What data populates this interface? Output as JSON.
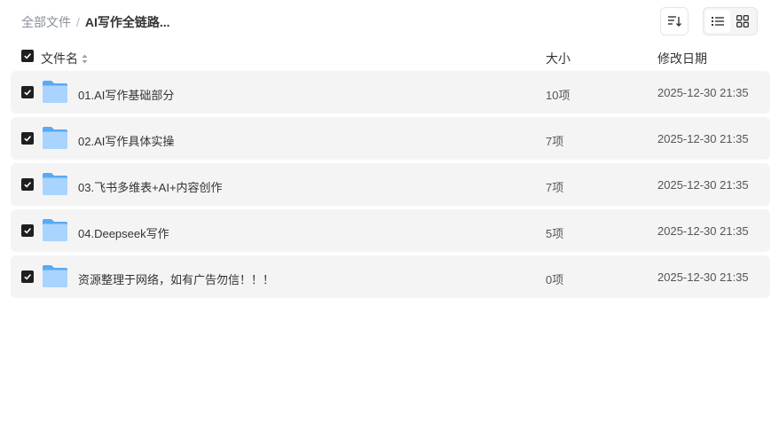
{
  "breadcrumb": {
    "root": "全部文件",
    "separator": "/",
    "current": "AI写作全链路..."
  },
  "toolbar": {
    "sort_icon": "sort-icon",
    "list_view_icon": "list-view-icon",
    "grid_view_icon": "grid-view-icon",
    "active_view": "list"
  },
  "columns": {
    "name": "文件名",
    "size": "大小",
    "date": "修改日期"
  },
  "rows": [
    {
      "name": "01.AI写作基础部分",
      "size": "10项",
      "date": "2025-12-30 21:35",
      "checked": true
    },
    {
      "name": "02.AI写作具体实操",
      "size": "7项",
      "date": "2025-12-30 21:35",
      "checked": true
    },
    {
      "name": "03.飞书多维表+AI+内容创作",
      "size": "7项",
      "date": "2025-12-30 21:35",
      "checked": true
    },
    {
      "name": "04.Deepseek写作",
      "size": "5项",
      "date": "2025-12-30 21:35",
      "checked": true
    },
    {
      "name": "资源整理于网络，如有广告勿信！！！",
      "size": "0项",
      "date": "2025-12-30 21:35",
      "checked": true
    }
  ],
  "colors": {
    "row_bg": "#f4f4f5",
    "checkbox": "#1f1f1f",
    "folder_light": "#a9d4ff",
    "folder_dark": "#5aa9f5"
  }
}
